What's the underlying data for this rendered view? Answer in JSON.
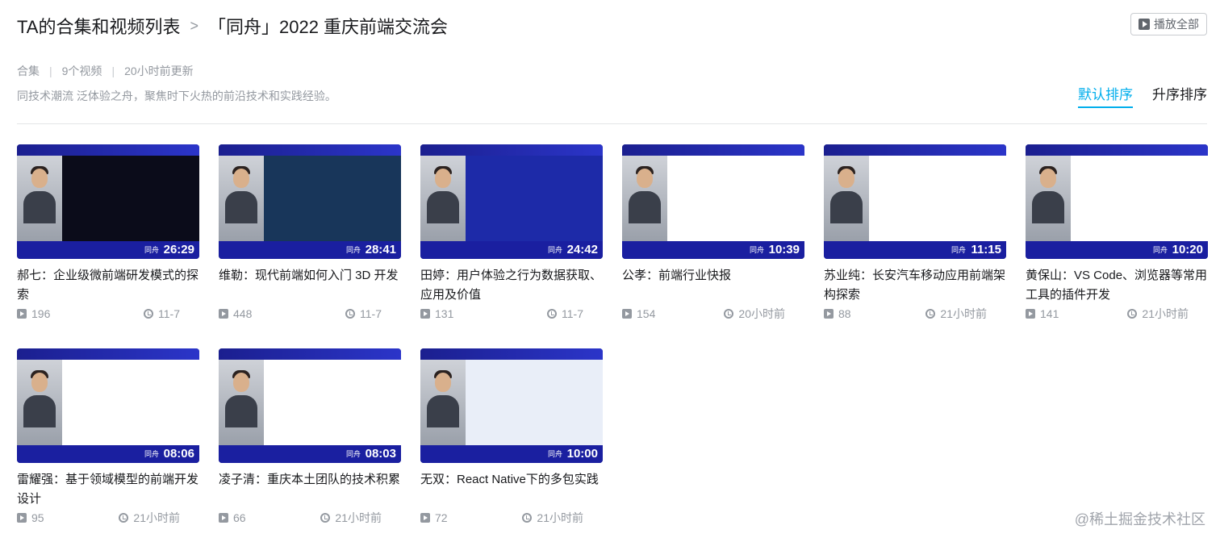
{
  "header": {
    "root": "TA的合集和视频列表",
    "separator": ">",
    "title": "「同舟」2022 重庆前端交流会",
    "play_all": "播放全部"
  },
  "meta": {
    "type": "合集",
    "count": "9个视频",
    "updated": "20小时前更新",
    "description": "同技术潮流 泛体验之舟，聚焦时下火热的前沿技术和实践经验。"
  },
  "sort": {
    "default": "默认排序",
    "asc": "升序排序"
  },
  "videos": [
    {
      "title": "郝七：企业级微前端研发模式的探索",
      "views": "196",
      "date": "11-7",
      "duration": "26:29",
      "logo": "同舟",
      "slide_bg": "#0b0c1a"
    },
    {
      "title": "维勒：现代前端如何入门 3D 开发",
      "views": "448",
      "date": "11-7",
      "duration": "28:41",
      "logo": "同舟",
      "slide_bg": "#18365a"
    },
    {
      "title": "田婷：用户体验之行为数据获取、应用及价值",
      "views": "131",
      "date": "11-7",
      "duration": "24:42",
      "logo": "同舟",
      "slide_bg": "#1d2aa8"
    },
    {
      "title": "公孝：前端行业快报",
      "views": "154",
      "date": "20小时前",
      "duration": "10:39",
      "logo": "同舟",
      "slide_bg": "#ffffff"
    },
    {
      "title": "苏业纯：长安汽车移动应用前端架构探索",
      "views": "88",
      "date": "21小时前",
      "duration": "11:15",
      "logo": "同舟",
      "slide_bg": "#ffffff"
    },
    {
      "title": "黄保山：VS Code、浏览器等常用工具的插件开发",
      "views": "141",
      "date": "21小时前",
      "duration": "10:20",
      "logo": "同舟",
      "slide_bg": "#ffffff"
    },
    {
      "title": "雷耀强：基于领域模型的前端开发设计",
      "views": "95",
      "date": "21小时前",
      "duration": "08:06",
      "logo": "同舟",
      "slide_bg": "#ffffff"
    },
    {
      "title": "凌子清：重庆本土团队的技术积累",
      "views": "66",
      "date": "21小时前",
      "duration": "08:03",
      "logo": "同舟",
      "slide_bg": "#ffffff"
    },
    {
      "title": "无双：React Native下的多包实践",
      "views": "72",
      "date": "21小时前",
      "duration": "10:00",
      "logo": "同舟",
      "slide_bg": "#e9eef8"
    }
  ],
  "watermark": "@稀土掘金技术社区",
  "colors": {
    "accent": "#00aeec",
    "muted": "#9499a0",
    "text": "#18191c",
    "frame": "#1a1fa0"
  }
}
